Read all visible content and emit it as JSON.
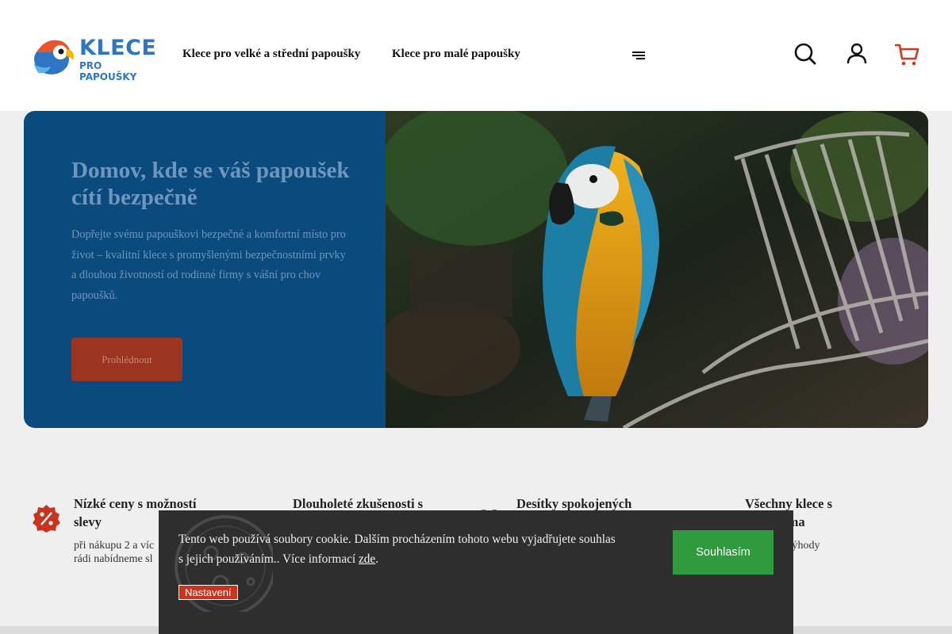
{
  "header": {
    "logo": {
      "line1": "KLECE",
      "line2": "PRO PAPOUŠKY"
    },
    "nav": [
      {
        "label": "Klece pro velké a střední papoušky"
      },
      {
        "label": "Klece pro malé papoušky"
      }
    ],
    "icons": [
      "menu-icon",
      "search-icon",
      "user-icon",
      "cart-icon"
    ]
  },
  "hero": {
    "title": "Domov, kde se váš papoušek cítí bezpečně",
    "text": "Dopřejte svému papouškovi bezpečné a komfortní místo pro život – kvalitní klece s promyšlenými bezpečnostními prvky a dlouhou životností od rodinné firmy s vášní pro chov papoušků.",
    "button": "Prohlédnout"
  },
  "features": [
    {
      "title": "Nízké ceny s možností slevy",
      "text": "při nákupu 2 a víc",
      "text2": "rádi nabídneme sl",
      "icon": "percent-badge-icon"
    },
    {
      "title": "Dlouholeté zkušenosti s",
      "text": "",
      "text2": "",
      "icon": "experience-icon"
    },
    {
      "title": "Desítky spokojených",
      "text": "",
      "text2": "",
      "icon": "heart-icon"
    },
    {
      "title": "Všechny klece s",
      "title2": "ou zdarma",
      "text": "kurenční výhody",
      "text2": "",
      "icon": "box-icon"
    }
  ],
  "cookie": {
    "text": "Tento web používá soubory cookie. Dalším procházením tohoto webu vyjadřujete souhlas s jejich používáním.. Více informací ",
    "link": "zde",
    "after_link": ".",
    "settings": "Nastavení",
    "accept": "Souhlasím"
  },
  "colors": {
    "brand_blue": "#2e76c4",
    "hero_bg": "#0b4a7d",
    "accent_red": "#c8341f",
    "accept_green": "#2f9b3c"
  }
}
